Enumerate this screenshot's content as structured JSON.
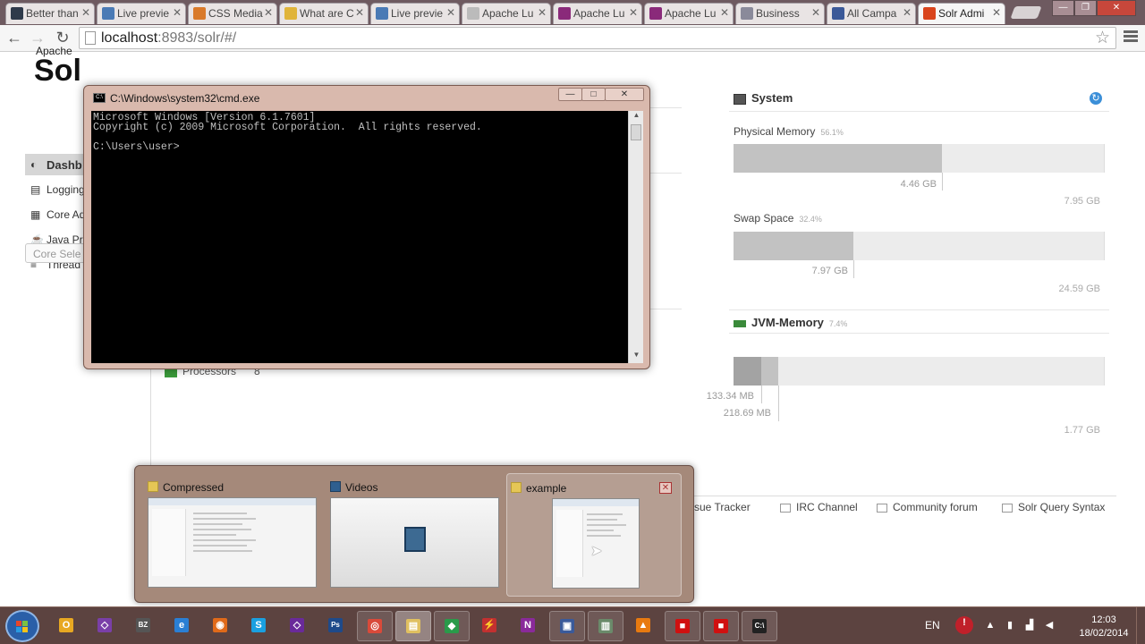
{
  "browser": {
    "tabs": [
      {
        "title": "Better than",
        "icon": "site-icon",
        "color": "#2f3a4a"
      },
      {
        "title": "Live previe",
        "icon": "cat-icon",
        "color": "#4a7ab5"
      },
      {
        "title": "CSS Media",
        "icon": "asterisk-icon",
        "color": "#d97a2a"
      },
      {
        "title": "What are C",
        "icon": "folder-icon",
        "color": "#e0b43a"
      },
      {
        "title": "Live previe",
        "icon": "cat-icon",
        "color": "#4a7ab5"
      },
      {
        "title": "Apache Lu",
        "icon": "page-icon",
        "color": "#bbbbbb"
      },
      {
        "title": "Apache Lu",
        "icon": "feather-icon",
        "color": "#8a2a7a"
      },
      {
        "title": "Apache Lu",
        "icon": "feather-icon",
        "color": "#8a2a7a"
      },
      {
        "title": "Business",
        "icon": "page-icon",
        "color": "#8a8a9a"
      },
      {
        "title": "All Campa",
        "icon": "facebook-icon",
        "color": "#3b5998"
      },
      {
        "title": "Solr Admi",
        "icon": "solr-icon",
        "color": "#d9441c",
        "active": true
      }
    ],
    "url_host": "localhost",
    "url_rest": ":8983/solr/#/"
  },
  "solr": {
    "logo_top": "Apache",
    "logo_main": "Sol",
    "nav": [
      {
        "label": "Dashb",
        "icon": "dashboard-icon",
        "active": true
      },
      {
        "label": "Logging",
        "icon": "logging-icon"
      },
      {
        "label": "Core Ad",
        "icon": "core-admin-icon"
      },
      {
        "label": "Java Pro",
        "icon": "java-icon"
      },
      {
        "label": "Thread",
        "icon": "thread-icon"
      }
    ],
    "core_selector": "Core Sele",
    "processors_label": "Processors",
    "processors_value": "8",
    "system": {
      "title": "System",
      "physical": {
        "label": "Physical Memory",
        "pct": "56.1%",
        "used": "4.46 GB",
        "total": "7.95 GB",
        "fraction": 0.561
      },
      "swap": {
        "label": "Swap Space",
        "pct": "32.4%",
        "used": "7.97 GB",
        "total": "24.59 GB",
        "fraction": 0.324
      }
    },
    "jvm": {
      "title": "JVM-Memory",
      "pct": "7.4%",
      "used": "133.34 MB",
      "committed": "218.69 MB",
      "max": "1.77 GB",
      "used_fraction": 0.074,
      "committed_fraction": 0.121
    },
    "footer": [
      {
        "label": "ssue Tracker",
        "icon": "bug-icon"
      },
      {
        "label": "IRC Channel",
        "icon": "people-icon"
      },
      {
        "label": "Community forum",
        "icon": "mail-icon"
      },
      {
        "label": "Solr Query Syntax",
        "icon": "doc-icon"
      }
    ]
  },
  "cmd": {
    "title": "C:\\Windows\\system32\\cmd.exe",
    "lines": "Microsoft Windows [Version 6.1.7601]\nCopyright (c) 2009 Microsoft Corporation.  All rights reserved.\n\nC:\\Users\\user>"
  },
  "flyout": {
    "windows": [
      {
        "title": "Compressed",
        "icon": "folder-icon"
      },
      {
        "title": "Videos",
        "icon": "videos-icon"
      },
      {
        "title": "example",
        "icon": "folder-icon",
        "hover": true
      }
    ]
  },
  "taskbar": {
    "items": [
      {
        "name": "outlook",
        "icon": "outlook-icon",
        "glyph": "O",
        "color": "#e8a822"
      },
      {
        "name": "visual-studio",
        "icon": "visual-studio-icon",
        "glyph": "◇",
        "color": "#7a3fa8"
      },
      {
        "name": "bz",
        "icon": "bz-icon",
        "glyph": "BZ",
        "color": "#555555"
      },
      {
        "name": "ie",
        "icon": "ie-icon",
        "glyph": "e",
        "color": "#2a7fd4"
      },
      {
        "name": "firefox",
        "icon": "firefox-icon",
        "glyph": "◉",
        "color": "#e06a1a"
      },
      {
        "name": "skype",
        "icon": "skype-icon",
        "glyph": "S",
        "color": "#1aa0e0"
      },
      {
        "name": "vs2",
        "icon": "visual-studio-icon",
        "glyph": "◇",
        "color": "#6a2a9a"
      },
      {
        "name": "photoshop",
        "icon": "photoshop-icon",
        "glyph": "Ps",
        "color": "#1e4a8a"
      },
      {
        "name": "chrome",
        "icon": "chrome-icon",
        "glyph": "◎",
        "color": "#d94a3a"
      },
      {
        "name": "explorer",
        "icon": "explorer-icon",
        "glyph": "▤",
        "color": "#e0c060"
      },
      {
        "name": "maps",
        "icon": "globe-icon",
        "glyph": "◆",
        "color": "#2a9a4a"
      },
      {
        "name": "filezilla",
        "icon": "filezilla-icon",
        "glyph": "⚡",
        "color": "#c23030"
      },
      {
        "name": "onenote",
        "icon": "onenote-icon",
        "glyph": "N",
        "color": "#8a2a9a"
      },
      {
        "name": "remote",
        "icon": "remote-desktop-icon",
        "glyph": "▣",
        "color": "#3a5a9a"
      },
      {
        "name": "explorer2",
        "icon": "window-icon",
        "glyph": "▥",
        "color": "#6a8a6a"
      },
      {
        "name": "vlc",
        "icon": "vlc-icon",
        "glyph": "▲",
        "color": "#e87a10"
      },
      {
        "name": "record1",
        "icon": "record-icon",
        "glyph": "■",
        "color": "#d01010"
      },
      {
        "name": "record2",
        "icon": "record-icon",
        "glyph": "■",
        "color": "#d01010"
      },
      {
        "name": "cmd",
        "icon": "cmd-icon",
        "glyph": "C:\\",
        "color": "#222222"
      }
    ],
    "lang": "EN",
    "time": "12:03",
    "date": "18/02/2014"
  }
}
